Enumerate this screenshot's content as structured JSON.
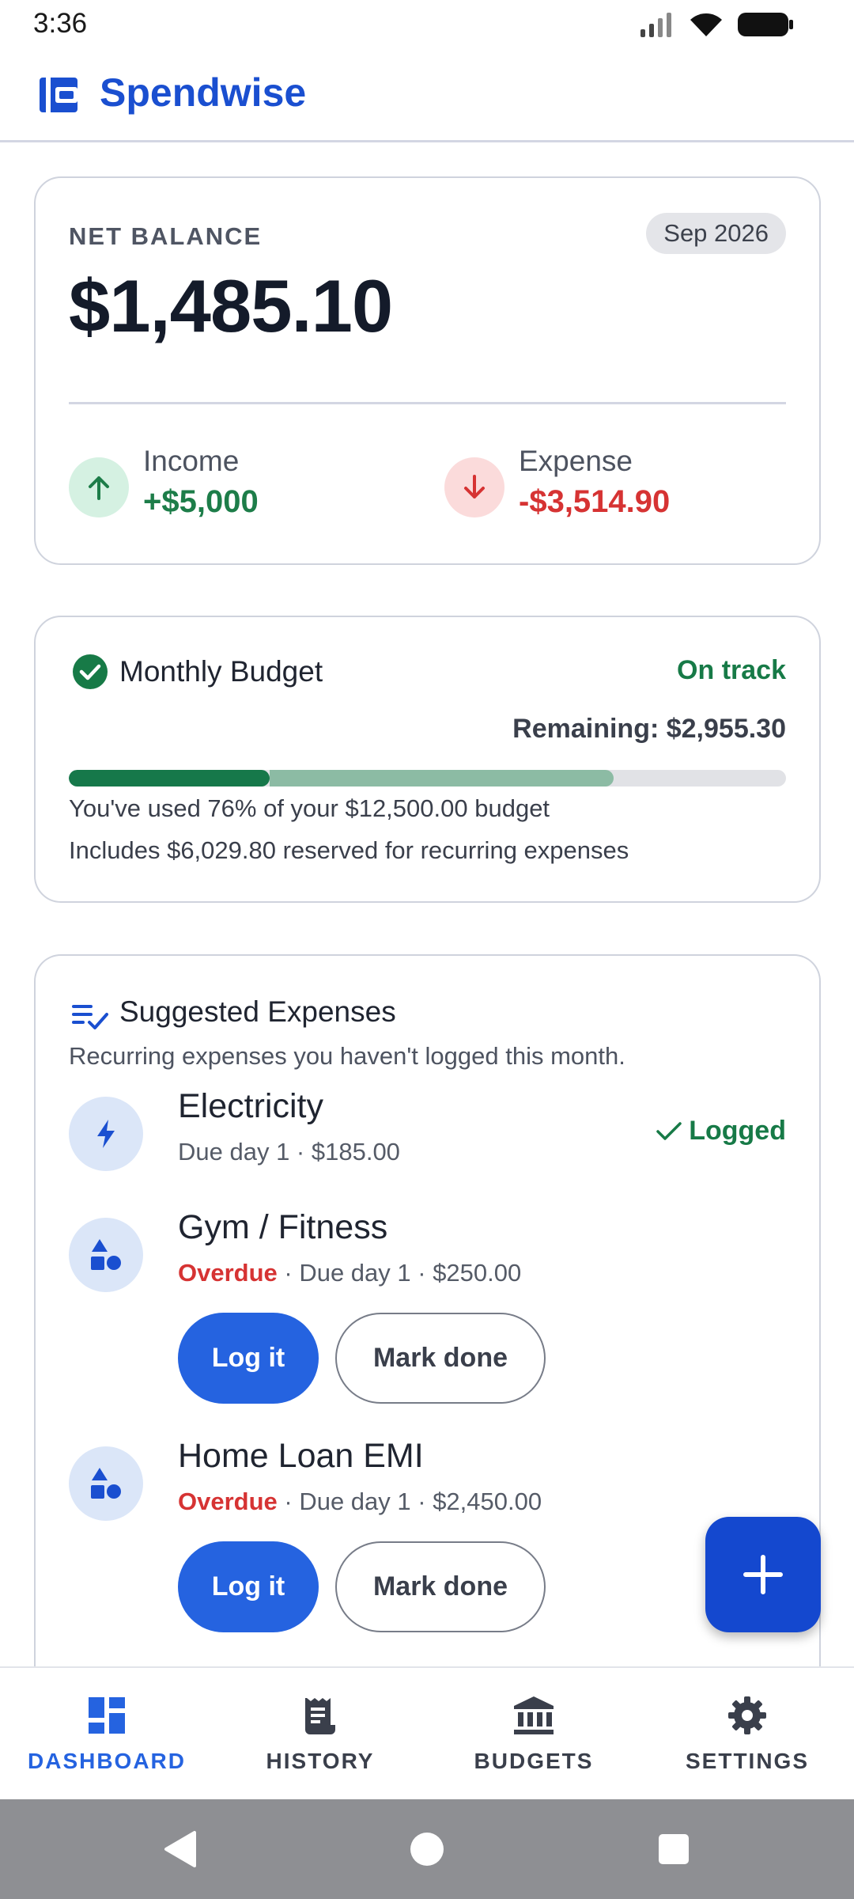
{
  "status_bar": {
    "time": "3:36"
  },
  "app": {
    "title": "Spendwise",
    "brand_color": "#1a4fd0"
  },
  "balance": {
    "label": "NET BALANCE",
    "period": "Sep 2026",
    "amount": "$1,485.10",
    "income": {
      "label": "Income",
      "value": "+$5,000",
      "icon": "arrow-up-icon",
      "color": "#1d7d49"
    },
    "expense": {
      "label": "Expense",
      "value": "-$3,514.90",
      "icon": "arrow-down-icon",
      "color": "#d63333"
    }
  },
  "budget": {
    "title": "Monthly Budget",
    "status": "On track",
    "remaining": "Remaining: $2,955.30",
    "used_fraction": 0.28,
    "reserved_fraction": 0.48,
    "used_text": "You've used 76% of your $12,500.00 budget",
    "reserve_text": "Includes $6,029.80 reserved for recurring expenses"
  },
  "suggestions": {
    "title": "Suggested Expenses",
    "subtitle": "Recurring expenses you haven't logged this month.",
    "items": [
      {
        "name": "Electricity",
        "meta": "Due day 1 · $185.00",
        "status": "Logged",
        "icon": "bolt-icon"
      },
      {
        "name": "Gym / Fitness",
        "overdue": "Overdue",
        "meta": " · Due day 1 · $250.00",
        "log_label": "Log it",
        "done_label": "Mark done",
        "icon": "category-shapes-icon"
      },
      {
        "name": "Home Loan EMI",
        "overdue": "Overdue",
        "meta": " · Due day 1 · $2,450.00",
        "log_label": "Log it",
        "done_label": "Mark done",
        "icon": "category-shapes-icon"
      }
    ]
  },
  "nav": {
    "items": [
      {
        "label": "DASHBOARD",
        "icon": "dashboard-icon",
        "active": true
      },
      {
        "label": "HISTORY",
        "icon": "receipt-icon",
        "active": false
      },
      {
        "label": "BUDGETS",
        "icon": "bank-icon",
        "active": false
      },
      {
        "label": "SETTINGS",
        "icon": "gear-icon",
        "active": false
      }
    ]
  },
  "colors": {
    "accent": "#2563e0",
    "fab": "#1448cf",
    "positive": "#177a47",
    "negative": "#d63333"
  }
}
